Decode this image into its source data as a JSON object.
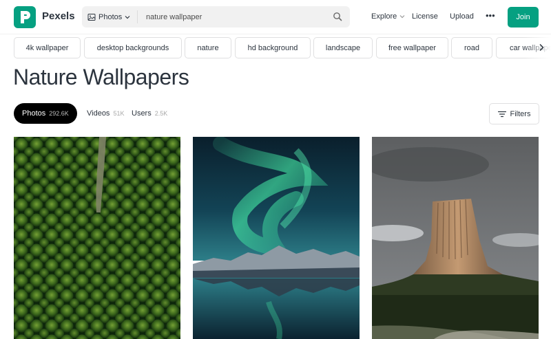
{
  "header": {
    "brand": "Pexels",
    "search": {
      "type_label": "Photos",
      "query": "nature wallpaper"
    },
    "nav": {
      "explore": "Explore",
      "license": "License",
      "upload": "Upload",
      "more": "•••"
    },
    "join_label": "Join"
  },
  "chips": [
    "4k wallpaper",
    "desktop backgrounds",
    "nature",
    "hd background",
    "landscape",
    "free wallpaper",
    "road",
    "car wallpaper"
  ],
  "page_title": "Nature Wallpapers",
  "tabs": [
    {
      "label": "Photos",
      "count": "292.6K",
      "active": true
    },
    {
      "label": "Videos",
      "count": "51K",
      "active": false
    },
    {
      "label": "Users",
      "count": "2.5K",
      "active": false
    }
  ],
  "filters_label": "Filters",
  "photos": [
    {
      "subject": "aerial forest road"
    },
    {
      "subject": "aurora over mountain lake"
    },
    {
      "subject": "devils tower rock formation"
    }
  ],
  "colors": {
    "brand": "#05a081",
    "text": "#2c343e",
    "active_tab": "#000000"
  }
}
